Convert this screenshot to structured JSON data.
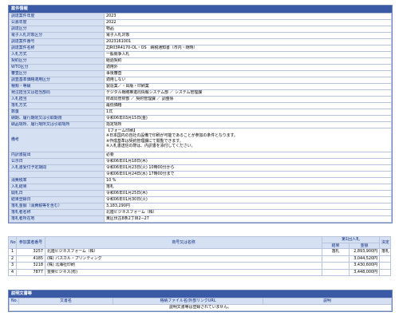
{
  "info_panel": {
    "title": "案件情報",
    "rows": [
      {
        "label": "調達案件年度",
        "value": "2023"
      },
      {
        "label": "公募年度",
        "value": "2022"
      },
      {
        "label": "調達区分",
        "value": "物品"
      },
      {
        "label": "電子入札対象区分",
        "value": "電子入札対象"
      },
      {
        "label": "調達案件番号",
        "value": "2023161001"
      },
      {
        "label": "調達案件名称",
        "value": "ZJR03R4170-OL・OS　納税通知書（市内・随時）"
      },
      {
        "label": "入札方式",
        "value": "一般競争入札"
      },
      {
        "label": "契約区分",
        "value": "経過契約"
      },
      {
        "label": "WTO区分",
        "value": "適用外"
      },
      {
        "label": "審査区分",
        "value": "事後審査"
      },
      {
        "label": "調査基準価格適用区分",
        "value": "適用しない"
      },
      {
        "label": "種類・等級",
        "value": "製造業／・出版・印刷業"
      },
      {
        "label": "発注担当又は担当部局",
        "value": "デジタル戦略推進局情報システム部 ／ システム管理課"
      },
      {
        "label": "入札担当",
        "value": "財政局管財部 ／ 契約管理課 ／ 調整係"
      },
      {
        "label": "落札方式",
        "value": "最低価格"
      },
      {
        "label": "数量",
        "value": "1式"
      },
      {
        "label": "納期、履行期限又は引取期限",
        "value": "令和06年03月15日(金)"
      },
      {
        "label": "納品場所、履行場所又は引取場所",
        "value": "指定場所"
      }
    ],
    "remarks_label": "備考",
    "remarks_lines": [
      "【フォーム印刷】",
      "※日本国内の自社の設備で印刷が可能であることが参加の条件となります。",
      "※作成基準は契約管理課にて閲覧できます。",
      "※入札書送信の際は、内訳書を添付してください。"
    ],
    "rows2": [
      {
        "label": "内訳書提出",
        "value": "必要"
      },
      {
        "label": "公示日",
        "value": "令和06年01月18日(木)"
      },
      {
        "label": "入札書受付予定期間",
        "value": "令和06年01月23日(火) 10時00分から"
      },
      {
        "label": "",
        "value": "令和06年01月24日(水) 17時00分まで"
      },
      {
        "label": "消費税率",
        "value": "10 %"
      },
      {
        "label": "入札結果",
        "value": "落札"
      },
      {
        "label": "開札日",
        "value": "令和06年01月25日(木)"
      },
      {
        "label": "結果登録日",
        "value": "令和06年01月30日(火)"
      },
      {
        "label": "落札金額（消費税等を含む）",
        "value": "3,183,290円"
      },
      {
        "label": "落札者名称",
        "value": "北陸ビジネスフォーム（株）"
      },
      {
        "label": "落札者所在地",
        "value": "東区伏古8条2丁目2−27"
      }
    ]
  },
  "bids": {
    "headers": {
      "no": "No.",
      "bidder_no": "参加業者番号",
      "name": "商号又は名称",
      "round1": "第1回入札",
      "result": "結果",
      "amount": "金額",
      "decision": "決定"
    },
    "rows": [
      {
        "no": "1",
        "bidder_no": "3257",
        "name": "北陸ビジネスフォーム（株）",
        "result": "落札",
        "amount": "2,893,900円",
        "decision": "落札"
      },
      {
        "no": "2",
        "bidder_no": "4185",
        "name": "(株) パスカル・プリンティング",
        "result": "",
        "amount": "3,044,520円",
        "decision": ""
      },
      {
        "no": "3",
        "bidder_no": "3218",
        "name": "(株) 北海社印刷",
        "result": "",
        "amount": "3,430,600円",
        "decision": ""
      },
      {
        "no": "4",
        "bidder_no": "7877",
        "name": "豊榮ビジネス(有)",
        "result": "",
        "amount": "3,448,000円",
        "decision": ""
      }
    ]
  },
  "docs_panel": {
    "title": "説明文書等",
    "headers": {
      "no": "No.",
      "doc_name": "文書名",
      "file": "格納ファイル名/外部リンクURL",
      "note": "説明"
    },
    "empty_message": "説明文書等は登録されていません。"
  },
  "colors": {
    "header_bg": "#3b5aa6",
    "label_bg": "#d5e0f2",
    "label_text": "#0a2a80"
  }
}
